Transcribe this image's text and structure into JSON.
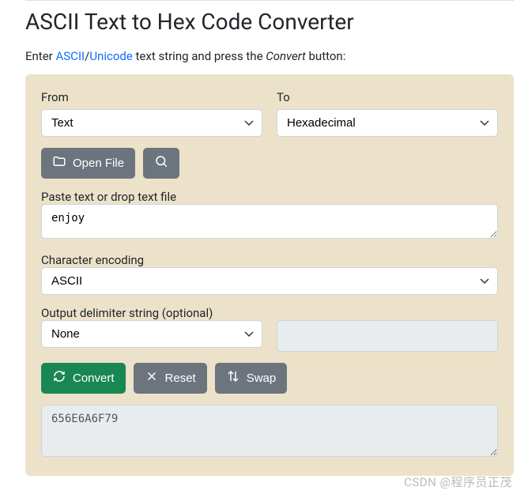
{
  "title": "ASCII Text to Hex Code Converter",
  "intro": {
    "prefix": "Enter ",
    "link_ascii": "ASCII",
    "slash": "/",
    "link_unicode": "Unicode",
    "mid": " text string and press the ",
    "convert_em": "Convert",
    "suffix": " button:"
  },
  "form": {
    "from_label": "From",
    "from_value": "Text",
    "to_label": "To",
    "to_value": "Hexadecimal",
    "open_file": "Open File",
    "paste_label": "Paste text or drop text file",
    "input_value": "enjoy",
    "encoding_label": "Character encoding",
    "encoding_value": "ASCII",
    "delimiter_label": "Output delimiter string (optional)",
    "delimiter_value": "None",
    "convert": "Convert",
    "reset": "Reset",
    "swap": "Swap",
    "output_value": "656E6A6F79"
  },
  "watermark": "CSDN @程序员正茂"
}
